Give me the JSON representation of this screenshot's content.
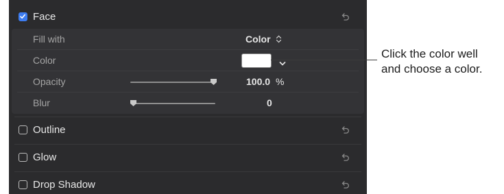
{
  "face": {
    "title": "Face",
    "checked": true,
    "fill_with": {
      "label": "Fill with",
      "value": "Color"
    },
    "color": {
      "label": "Color",
      "swatch": "#ffffff"
    },
    "opacity": {
      "label": "Opacity",
      "value": "100.0",
      "unit": "%",
      "level": 1.0
    },
    "blur": {
      "label": "Blur",
      "value": "0",
      "level": 0.0
    }
  },
  "outline": {
    "title": "Outline",
    "checked": false
  },
  "glow": {
    "title": "Glow",
    "checked": false
  },
  "drop_shadow": {
    "title": "Drop Shadow",
    "checked": false
  },
  "callout": {
    "line1": "Click the color well",
    "line2": "and choose a color."
  },
  "colors": {
    "panel_bg": "#2b2b2d",
    "subpanel_bg": "#333336",
    "accent": "#3d7cf0"
  }
}
